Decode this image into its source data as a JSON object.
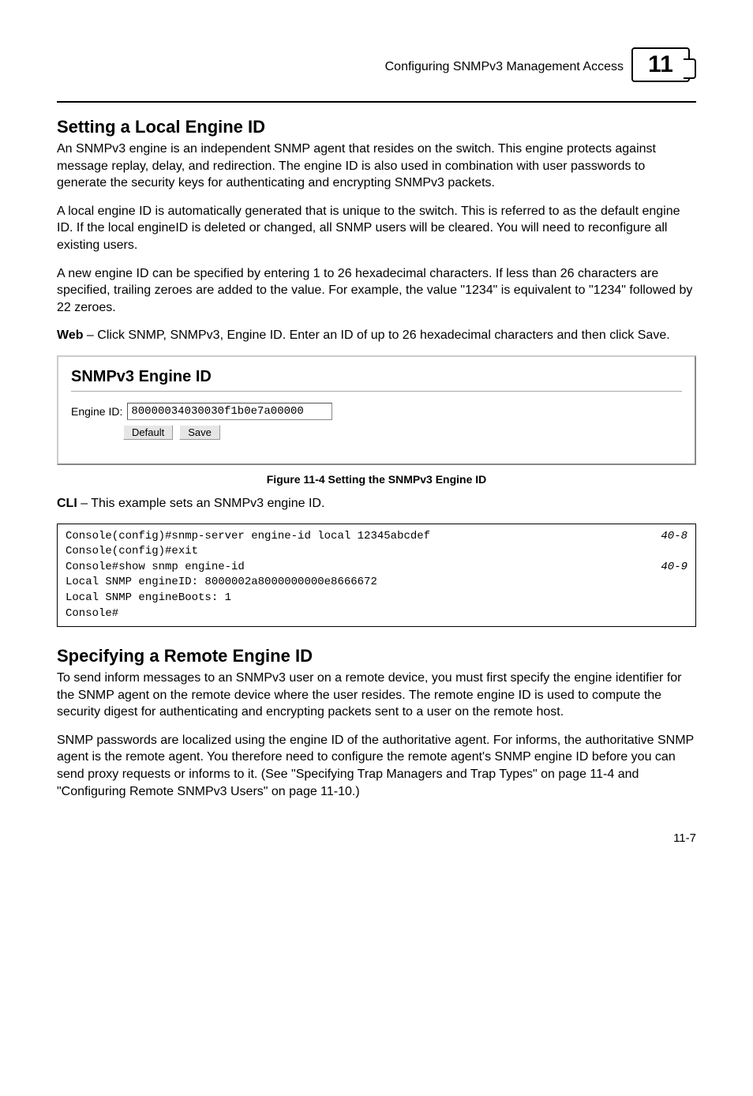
{
  "header": {
    "running_title": "Configuring SNMPv3 Management Access",
    "chapter_number": "11"
  },
  "section1": {
    "title": "Setting a Local Engine ID",
    "para1": "An SNMPv3 engine is an independent SNMP agent that resides on the switch. This engine protects against message replay, delay, and redirection. The engine ID is also used in combination with user passwords to generate the security keys for authenticating and encrypting SNMPv3 packets.",
    "para2": "A local engine ID is automatically generated that is unique to the switch. This is referred to as the default engine ID. If the local engineID is deleted or changed, all SNMP users will be cleared. You will need to reconfigure all existing users.",
    "para3": "A new engine ID can be specified by entering 1 to 26 hexadecimal characters. If less than 26 characters are specified, trailing zeroes are added to the value. For example, the value \"1234\" is equivalent to \"1234\" followed by 22 zeroes.",
    "para4_bold": "Web",
    "para4_rest": " – Click SNMP, SNMPv3, Engine ID. Enter an ID of up to 26 hexadecimal characters and then click Save."
  },
  "widget": {
    "title": "SNMPv3 Engine ID",
    "label": "Engine ID:",
    "value": "80000034030030f1b0e7a00000",
    "btn_default": "Default",
    "btn_save": "Save"
  },
  "figure_caption": "Figure 11-4  Setting the SNMPv3 Engine ID",
  "cli_intro_bold": "CLI",
  "cli_intro_rest": " – This example sets an SNMPv3 engine ID.",
  "cli": {
    "line1_cmd": "Console(config)#snmp-server engine-id local 12345abcdef",
    "line1_ref": "40-8",
    "line2": "Console(config)#exit",
    "line3_cmd": "Console#show snmp engine-id",
    "line3_ref": "40-9",
    "line4": "Local SNMP engineID: 8000002a8000000000e8666672",
    "line5": "Local SNMP engineBoots: 1",
    "line6": "Console#"
  },
  "section2": {
    "title": "Specifying a Remote Engine ID",
    "para1": "To send inform messages to an SNMPv3 user on a remote device, you must first specify the engine identifier for the SNMP agent on the remote device where the user resides. The remote engine ID is used to compute the security digest for authenticating and encrypting packets sent to a user on the remote host.",
    "para2": "SNMP passwords are localized using the engine ID of the authoritative agent. For informs, the authoritative SNMP agent is the remote agent. You therefore need to configure the remote agent's SNMP engine ID before you can send proxy requests or informs to it. (See \"Specifying Trap Managers and Trap Types\" on page 11-4 and \"Configuring Remote SNMPv3 Users\" on page 11-10.)"
  },
  "page_number": "11-7"
}
